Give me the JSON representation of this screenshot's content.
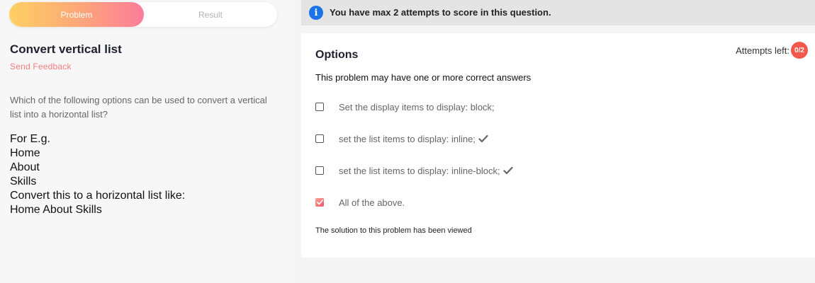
{
  "tabs": {
    "problem": "Problem",
    "result": "Result"
  },
  "question": {
    "title": "Convert vertical list",
    "feedback_link": "Send Feedback",
    "text": "Which of the following options can be used to convert a vertical list into a horizontal list?",
    "example_lines": [
      "For E.g.",
      "Home",
      "About",
      "Skills",
      "Convert this to a horizontal list like:",
      "Home About Skills"
    ]
  },
  "banner": {
    "icon": "info-icon",
    "text": "You have max 2 attempts to score in this question."
  },
  "options_card": {
    "title": "Options",
    "attempts_label": "Attempts left:",
    "attempts_value": "0/2",
    "subtitle": "This problem may have one or more correct answers",
    "options": [
      {
        "label": "Set the display items to display: block;",
        "checked": false,
        "correct": false
      },
      {
        "label": "set the list items to display: inline;",
        "checked": false,
        "correct": true
      },
      {
        "label": "set the list items to display: inline-block;",
        "checked": false,
        "correct": true
      },
      {
        "label": "All of the above.",
        "checked": true,
        "correct": false
      }
    ],
    "footer": "The solution to this problem has been viewed"
  },
  "colors": {
    "accent_start": "#fdd063",
    "accent_end": "#fc7d9a",
    "badge": "#f2594b",
    "info": "#1a73e8",
    "feedback": "#f47c7c"
  }
}
